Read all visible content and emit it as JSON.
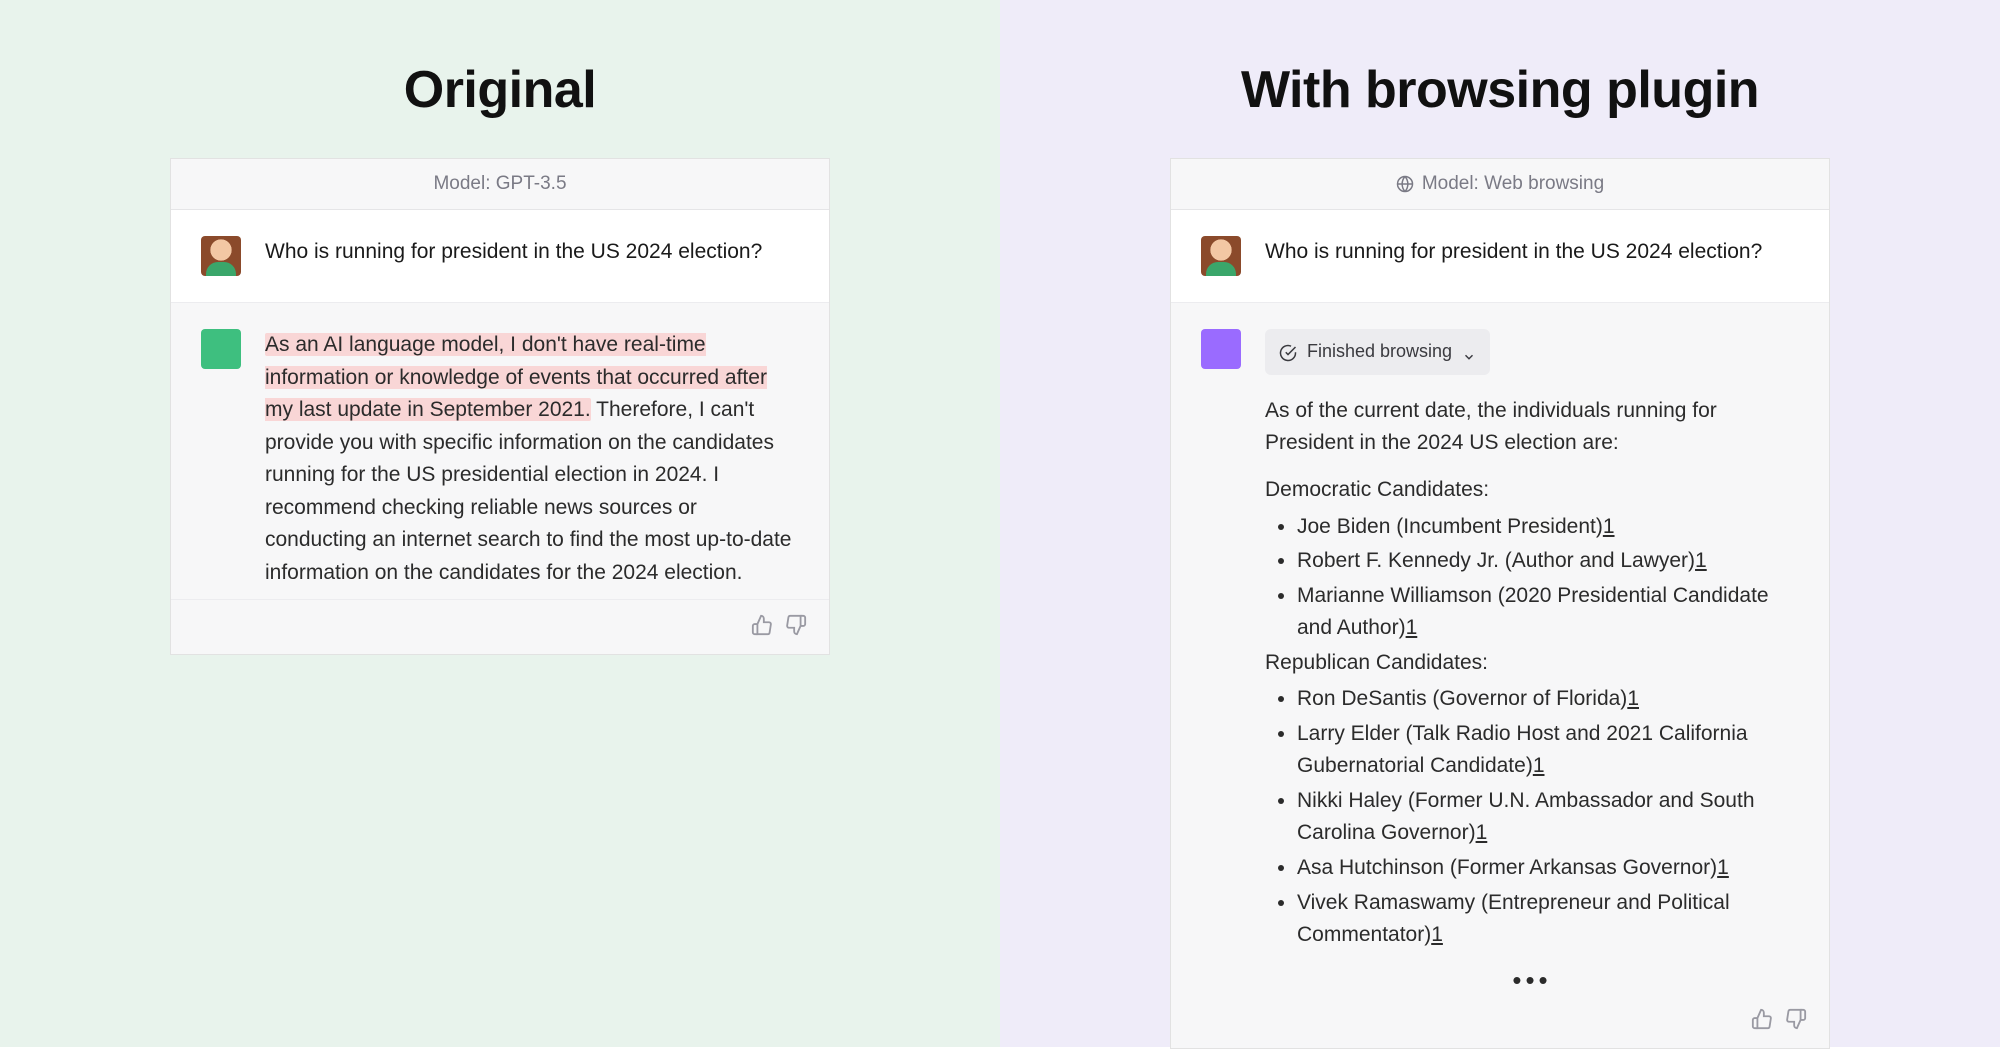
{
  "left": {
    "title": "Original",
    "model_label": "Model: GPT-3.5",
    "question": "Who is running for president in the US 2024 election?",
    "answer_highlight": "As an AI language model, I don't have real-time information or knowledge of events that occurred after my last update in September 2021.",
    "answer_rest": " Therefore, I can't provide you with specific information on the candidates running for the US presidential election in 2024. I recommend checking reliable news sources or conducting an internet search to find the most up-to-date information on the candidates for the 2024 election."
  },
  "right": {
    "title": "With browsing plugin",
    "model_label": "Model: Web browsing",
    "question": "Who is running for president in the US 2024 election?",
    "browsing_status": "Finished browsing",
    "intro": "As of the current date, the individuals running for President in the 2024 US election are:",
    "dem_header": "Democratic Candidates:",
    "dems": [
      {
        "text": "Joe Biden (Incumbent President)",
        "cite": "1"
      },
      {
        "text": "Robert F. Kennedy Jr. (Author and Lawyer)",
        "cite": "1"
      },
      {
        "text": "Marianne Williamson (2020 Presidential Candidate and Author)",
        "cite": "1"
      }
    ],
    "rep_header": "Republican Candidates:",
    "reps": [
      {
        "text": "Ron DeSantis (Governor of Florida)",
        "cite": "1"
      },
      {
        "text": "Larry Elder (Talk Radio Host and 2021 California Gubernatorial Candidate)",
        "cite": "1"
      },
      {
        "text": "Nikki Haley (Former U.N. Ambassador and South Carolina Governor)",
        "cite": "1"
      },
      {
        "text": "Asa Hutchinson (Former Arkansas Governor)",
        "cite": "1"
      },
      {
        "text": "Vivek Ramaswamy (Entrepreneur and Political Commentator)",
        "cite": "1"
      }
    ],
    "ellipsis": "•••"
  }
}
